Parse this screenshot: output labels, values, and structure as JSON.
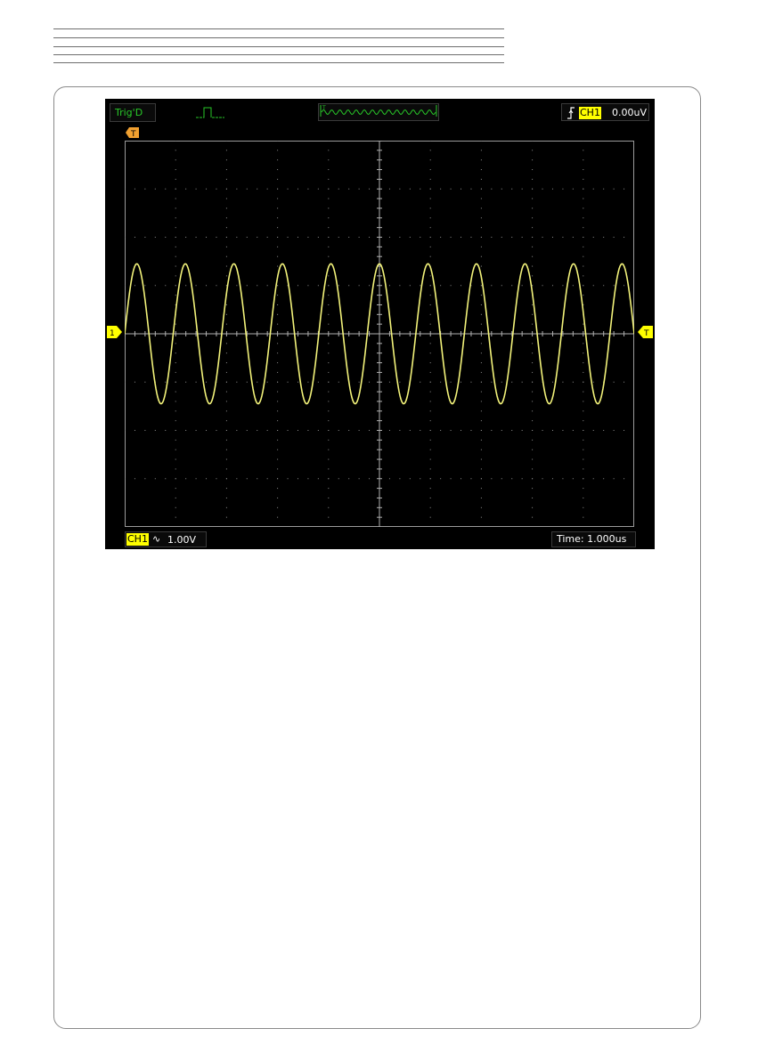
{
  "scope": {
    "trigger_state": "Trig'D",
    "trigger_channel": "CH1",
    "trigger_level": "0.00uV",
    "trigger_position_marker": "T",
    "channel_label": "CH1",
    "coupling_symbol": "∿",
    "volts_per_div": "1.00V",
    "timebase": "Time: 1.000us",
    "ground_marker": "1",
    "trigger_level_marker": "T"
  },
  "waveform": {
    "amplitude_div": 1.45,
    "cycles_on_screen": 10.5,
    "color": "#f2f27a"
  },
  "colors": {
    "trace": "#f2f27a",
    "marker": "#ffff00",
    "grid": "#8c8c8c",
    "status_green": "#29c929",
    "tpos_marker": "#f0a030"
  },
  "icons": {
    "pulse": "pulse-width-trigger-icon",
    "edge": "rising-edge-trigger-icon"
  }
}
